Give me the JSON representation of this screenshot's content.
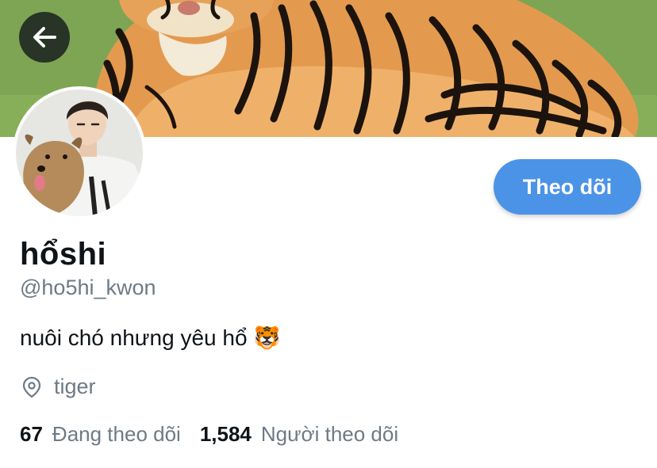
{
  "profile": {
    "display_name": "hổshi",
    "handle": "@ho5hi_kwon",
    "bio": "nuôi chó nhưng yêu hổ 🐯",
    "location": "tiger"
  },
  "actions": {
    "follow_label": "Theo dõi"
  },
  "stats": {
    "following_count": "67",
    "following_label": "Đang theo dõi",
    "followers_count": "1,584",
    "followers_label": "Người theo dõi"
  },
  "colors": {
    "accent": "#4b93e6",
    "text_primary": "#0f1419",
    "text_secondary": "#6e7a85"
  },
  "icons": {
    "back": "arrow-left-icon",
    "location": "location-pin-icon"
  }
}
